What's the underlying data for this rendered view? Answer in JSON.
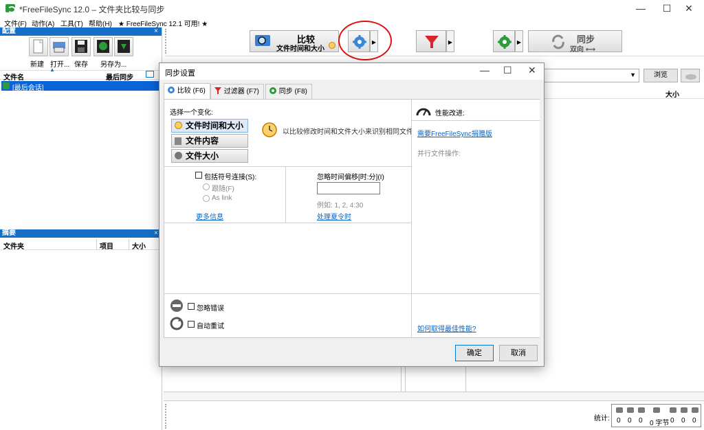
{
  "window": {
    "title": "*FreeFileSync 12.0 – 文件夹比较与同步",
    "min": "—",
    "max": "☐",
    "close": "✕"
  },
  "menu": [
    "文件(F)",
    "动作(A)",
    "工具(T)",
    "帮助(H)",
    "★ FreeFileSync 12.1 可用! ★"
  ],
  "config_panel": {
    "header": "配置",
    "close": "×",
    "buttons": [
      "新建",
      "打开...",
      "保存",
      "另存为..."
    ],
    "col_name": "文件名",
    "col_last_sync": "最后同步",
    "session_item": "[最后会话]"
  },
  "summary_panel": {
    "header": "摘要",
    "close": "×",
    "col_folder": "文件夹",
    "col_items": "项目",
    "col_size": "大小"
  },
  "toolbar": {
    "compare_label": "比较",
    "compare_sub": "文件时间和大小",
    "sync_label": "同步",
    "sync_sub": "双向 ⟷"
  },
  "main": {
    "browse": "浏览",
    "col_size": "大小",
    "stats_label": "统计:",
    "stats_values": [
      "0",
      "0",
      "0",
      "0 字节",
      "0",
      "0",
      "0"
    ]
  },
  "dialog": {
    "title": "同步设置",
    "tabs": [
      "比较 (F6)",
      "过滤器 (F7)",
      "同步 (F8)"
    ],
    "choose_variant": "选择一个变化:",
    "variants": [
      "文件时间和大小",
      "文件内容",
      "文件大小"
    ],
    "variant_desc": "以比较修改时间和文件大小来识别相同文件.",
    "symlinks_label": "包括符号连接(S):",
    "follow": "跟随(F)",
    "as_link": "As link",
    "more_info": "更多信息",
    "ignore_time_shift": "忽略时间偏移[时:分](I)",
    "time_shift_value": "",
    "example": "例如: 1, 2, 4:30",
    "handle_dst": "处理夏令时",
    "ignore_errors": "忽略错误",
    "auto_retry": "自动重试",
    "perf_title": "性能改进:",
    "donation_link": "需要FreeFileSync捐赠版",
    "parallel_ops": "并行文件操作:",
    "best_perf_link": "如何取得最佳性能?",
    "ok": "确定",
    "cancel": "取消"
  },
  "colors": {
    "panel_header": "#1670c8",
    "selection": "#0a64d8",
    "link": "#0066cc",
    "annotation": "#e01010"
  }
}
